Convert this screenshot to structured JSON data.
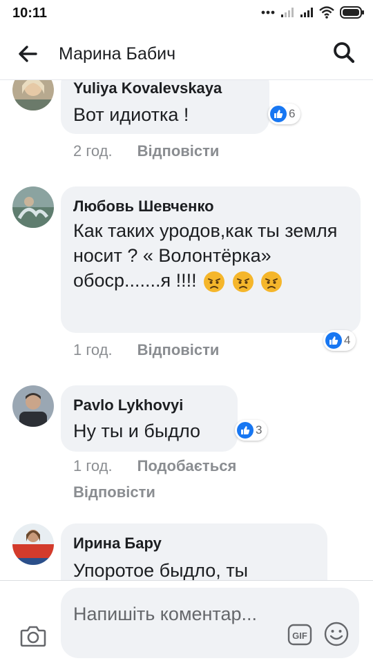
{
  "status_bar": {
    "time": "10:11"
  },
  "header": {
    "title": "Марина Бабич"
  },
  "comments": [
    {
      "author": "Yuliya  Kovalevskaya",
      "text": "Вот идиотка !",
      "reactions": "6",
      "time": "2 год.",
      "reply": "Відповісти"
    },
    {
      "author": "Любовь Шевченко",
      "text": "Как таких уродов,как ты земля носит ? « Волонтёрка» обоср.......я !!!!",
      "emojis": [
        "angry-face",
        "angry-face",
        "angry-face"
      ],
      "reactions": "4",
      "time": "1 год.",
      "reply": "Відповісти"
    },
    {
      "author": "Pavlo Lykhovyi",
      "text": "Ну ты и быдло",
      "reactions": "3",
      "time": "1 год.",
      "like": "Подобається",
      "reply": "Відповісти"
    },
    {
      "author": "Ирина Бару",
      "text": "Упоротое быдло, ты"
    }
  ],
  "composer": {
    "placeholder": "Напишіть коментар..."
  },
  "colors": {
    "like_blue": "#1877f2",
    "bubble_bg": "#f0f2f5",
    "meta_gray": "#8a8d91"
  }
}
